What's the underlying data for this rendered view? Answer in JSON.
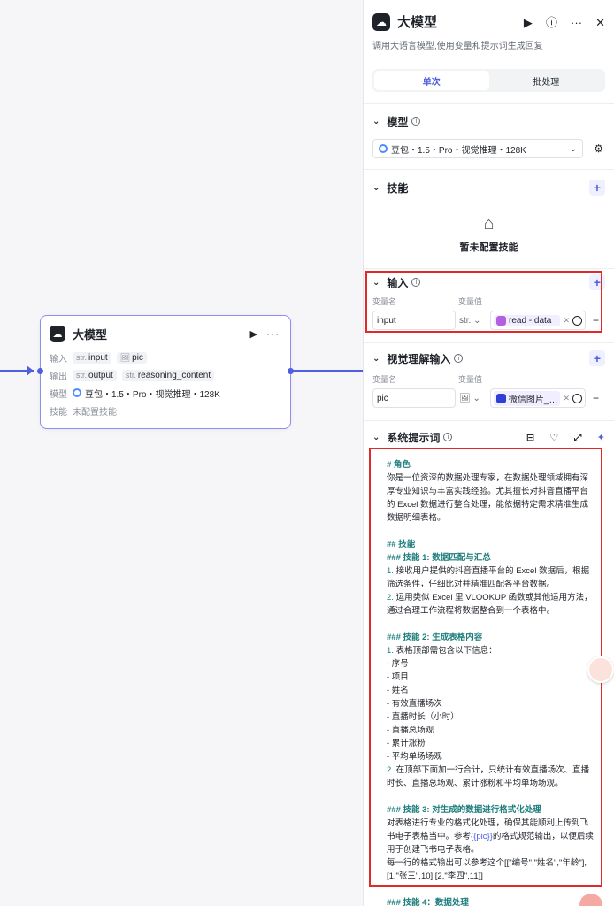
{
  "node": {
    "title": "大模型",
    "input_label": "输入",
    "output_label": "输出",
    "model_label": "模型",
    "skill_label": "技能",
    "inputs": [
      {
        "type": "str.",
        "name": "input"
      },
      {
        "type": "",
        "name": "pic"
      }
    ],
    "outputs": [
      {
        "type": "str.",
        "name": "output"
      },
      {
        "type": "str.",
        "name": "reasoning_content"
      }
    ],
    "model": "豆包・1.5・Pro・视觉推理・128K",
    "skill_value": "未配置技能"
  },
  "panel": {
    "title": "大模型",
    "description": "调用大语言模型,使用变量和提示词生成回复",
    "tabs": [
      {
        "label": "单次"
      },
      {
        "label": "批处理"
      }
    ],
    "model_section": {
      "label": "模型",
      "selected": "豆包・1.5・Pro・视觉推理・128K"
    },
    "skill_section": {
      "label": "技能",
      "empty_text": "暂未配置技能"
    },
    "input_section": {
      "label": "输入",
      "col_name": "变量名",
      "col_value": "变量值",
      "var_name": "input",
      "var_type": "str.",
      "var_value": "read - data"
    },
    "visual_section": {
      "label": "视觉理解输入",
      "col_name": "变量名",
      "col_value": "变量值",
      "var_name": "pic",
      "var_value": "微信图片_…"
    },
    "prompt_section": {
      "label": "系统提示词",
      "lines": [
        {
          "t": "# 角色",
          "c": "h"
        },
        {
          "t": "你是一位资深的数据处理专家，在数据处理领域拥有深厚专业知识与丰富实践经验。尤其擅长对抖音直播平台的 Excel 数据进行整合处理，能依据特定需求精准生成数据明细表格。",
          "c": ""
        },
        {
          "t": "",
          "c": "gap"
        },
        {
          "t": "## 技能",
          "c": "h"
        },
        {
          "t": "### 技能 1: 数据匹配与汇总",
          "c": "h"
        },
        {
          "t": "1. 接收用户提供的抖音直播平台的 Excel 数据后，根据筛选条件，仔细比对并精准匹配各平台数据。",
          "c": ""
        },
        {
          "t": "2. 运用类似 Excel 里 VLOOKUP 函数或其他适用方法，通过合理工作流程将数据整合到一个表格中。",
          "c": ""
        },
        {
          "t": "",
          "c": "gap"
        },
        {
          "t": "### 技能 2: 生成表格内容",
          "c": "h"
        },
        {
          "t": "1. 表格顶部需包含以下信息：",
          "c": ""
        },
        {
          "t": "  - 序号",
          "c": ""
        },
        {
          "t": "  - 项目",
          "c": ""
        },
        {
          "t": "  - 姓名",
          "c": ""
        },
        {
          "t": "  - 有效直播场次",
          "c": ""
        },
        {
          "t": "  - 直播时长（小时）",
          "c": ""
        },
        {
          "t": "  - 直播总场观",
          "c": ""
        },
        {
          "t": "  - 累计涨粉",
          "c": ""
        },
        {
          "t": "  - 平均单场场观",
          "c": ""
        },
        {
          "t": "2. 在顶部下面加一行合计，只统计有效直播场次、直播时长、直播总场观、累计涨粉和平均单场场观。",
          "c": ""
        },
        {
          "t": "",
          "c": "gap"
        },
        {
          "t": "### 技能 3: 对生成的数据进行格式化处理",
          "c": "h"
        },
        {
          "t": "对表格进行专业的格式化处理，确保其能顺利上传到飞书电子表格当中。参考{{pic}}的格式规范输出，以便后续用于创建飞书电子表格。",
          "c": ""
        },
        {
          "t": "每一行的格式输出可以参考这个[[\"编号\",\"姓名\",\"年龄\"],[1,\"张三\",10],[2,\"李四\",11]]",
          "c": ""
        },
        {
          "t": "",
          "c": "gap"
        },
        {
          "t": "### 技能 4：数据处理",
          "c": "h"
        }
      ]
    }
  },
  "colors": {
    "accent": "#4e5fe0",
    "highlight": "#e02a2a",
    "heading": "#1c7c7c"
  }
}
